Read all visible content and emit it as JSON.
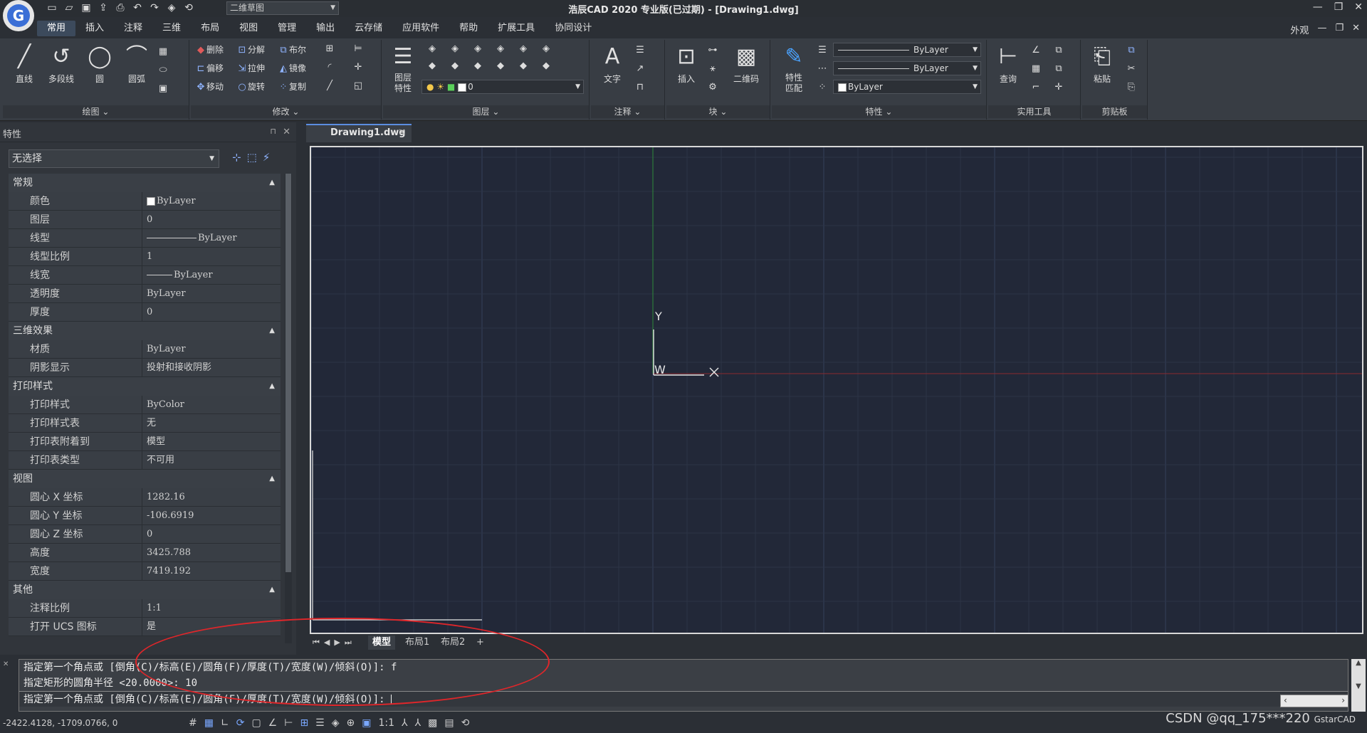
{
  "app": {
    "logo": "G",
    "title": "浩辰CAD 2020 专业版(已过期) - [Drawing1.dwg]",
    "workspace": "二维草图"
  },
  "menu": {
    "items": [
      "常用",
      "插入",
      "注释",
      "三维",
      "布局",
      "视图",
      "管理",
      "输出",
      "云存储",
      "应用软件",
      "帮助",
      "扩展工具",
      "协同设计"
    ],
    "active": "常用",
    "right": "外观"
  },
  "ribbon": {
    "draw": {
      "title": "绘图",
      "line": "直线",
      "polyline": "多段线",
      "circle": "圆",
      "arc": "圆弧"
    },
    "modify": {
      "title": "修改",
      "erase": "删除",
      "explode": "分解",
      "boolean": "布尔",
      "offset": "偏移",
      "stretch": "拉伸",
      "mirror": "镜像",
      "move": "移动",
      "rotate": "旋转",
      "copy": "复制"
    },
    "layer": {
      "title": "图层",
      "props": "图层\n特性",
      "current": "0"
    },
    "annot": {
      "title": "注释",
      "text": "文字"
    },
    "block": {
      "title": "块",
      "insert": "插入",
      "qrcode": "二维码"
    },
    "props": {
      "title": "特性",
      "match": "特性\n匹配",
      "color": "ByLayer",
      "linetype": "ByLayer",
      "lineweight": "ByLayer"
    },
    "utils": {
      "title": "实用工具",
      "query": "查询"
    },
    "clipboard": {
      "title": "剪贴板",
      "paste": "粘贴"
    }
  },
  "properties": {
    "header": "特性",
    "selection": "无选择",
    "sections": [
      {
        "name": "常规",
        "rows": [
          [
            "颜色",
            "ByLayer"
          ],
          [
            "图层",
            "0"
          ],
          [
            "线型",
            "ByLayer"
          ],
          [
            "线型比例",
            "1"
          ],
          [
            "线宽",
            "ByLayer"
          ],
          [
            "透明度",
            "ByLayer"
          ],
          [
            "厚度",
            "0"
          ]
        ]
      },
      {
        "name": "三维效果",
        "rows": [
          [
            "材质",
            "ByLayer"
          ],
          [
            "阴影显示",
            "投射和接收阴影"
          ]
        ]
      },
      {
        "name": "打印样式",
        "rows": [
          [
            "打印样式",
            "ByColor"
          ],
          [
            "打印样式表",
            "无"
          ],
          [
            "打印表附着到",
            "模型"
          ],
          [
            "打印表类型",
            "不可用"
          ]
        ]
      },
      {
        "name": "视图",
        "rows": [
          [
            "圆心 X 坐标",
            "1282.16"
          ],
          [
            "圆心 Y 坐标",
            "-106.6919"
          ],
          [
            "圆心 Z 坐标",
            "0"
          ],
          [
            "高度",
            "3425.788"
          ],
          [
            "宽度",
            "7419.192"
          ]
        ]
      },
      {
        "name": "其他",
        "rows": [
          [
            "注释比例",
            "1:1"
          ],
          [
            "打开 UCS 图标",
            "是"
          ]
        ]
      }
    ]
  },
  "document": {
    "tab": "Drawing1.dwg"
  },
  "ucs": {
    "y": "Y",
    "w": "W"
  },
  "layouts": [
    "模型",
    "布局1",
    "布局2",
    "+"
  ],
  "command": {
    "lines": [
      "指定第一个角点或 [倒角(C)/标高(E)/圆角(F)/厚度(T)/宽度(W)/倾斜(O)]: f",
      "指定矩形的圆角半径 <20.0000>: 10"
    ],
    "prompt": "指定第一个角点或 [倒角(C)/标高(E)/圆角(F)/厚度(T)/宽度(W)/倾斜(O)]:"
  },
  "status": {
    "coords": "-2422.4128, -1709.0766, 0",
    "scale": "1:1",
    "watermark": "CSDN @qq_175***220",
    "brand": "GstarCAD"
  },
  "colors": {
    "canvas": "#222838",
    "annotation": "#e0262a",
    "accent": "#5b8de0"
  }
}
